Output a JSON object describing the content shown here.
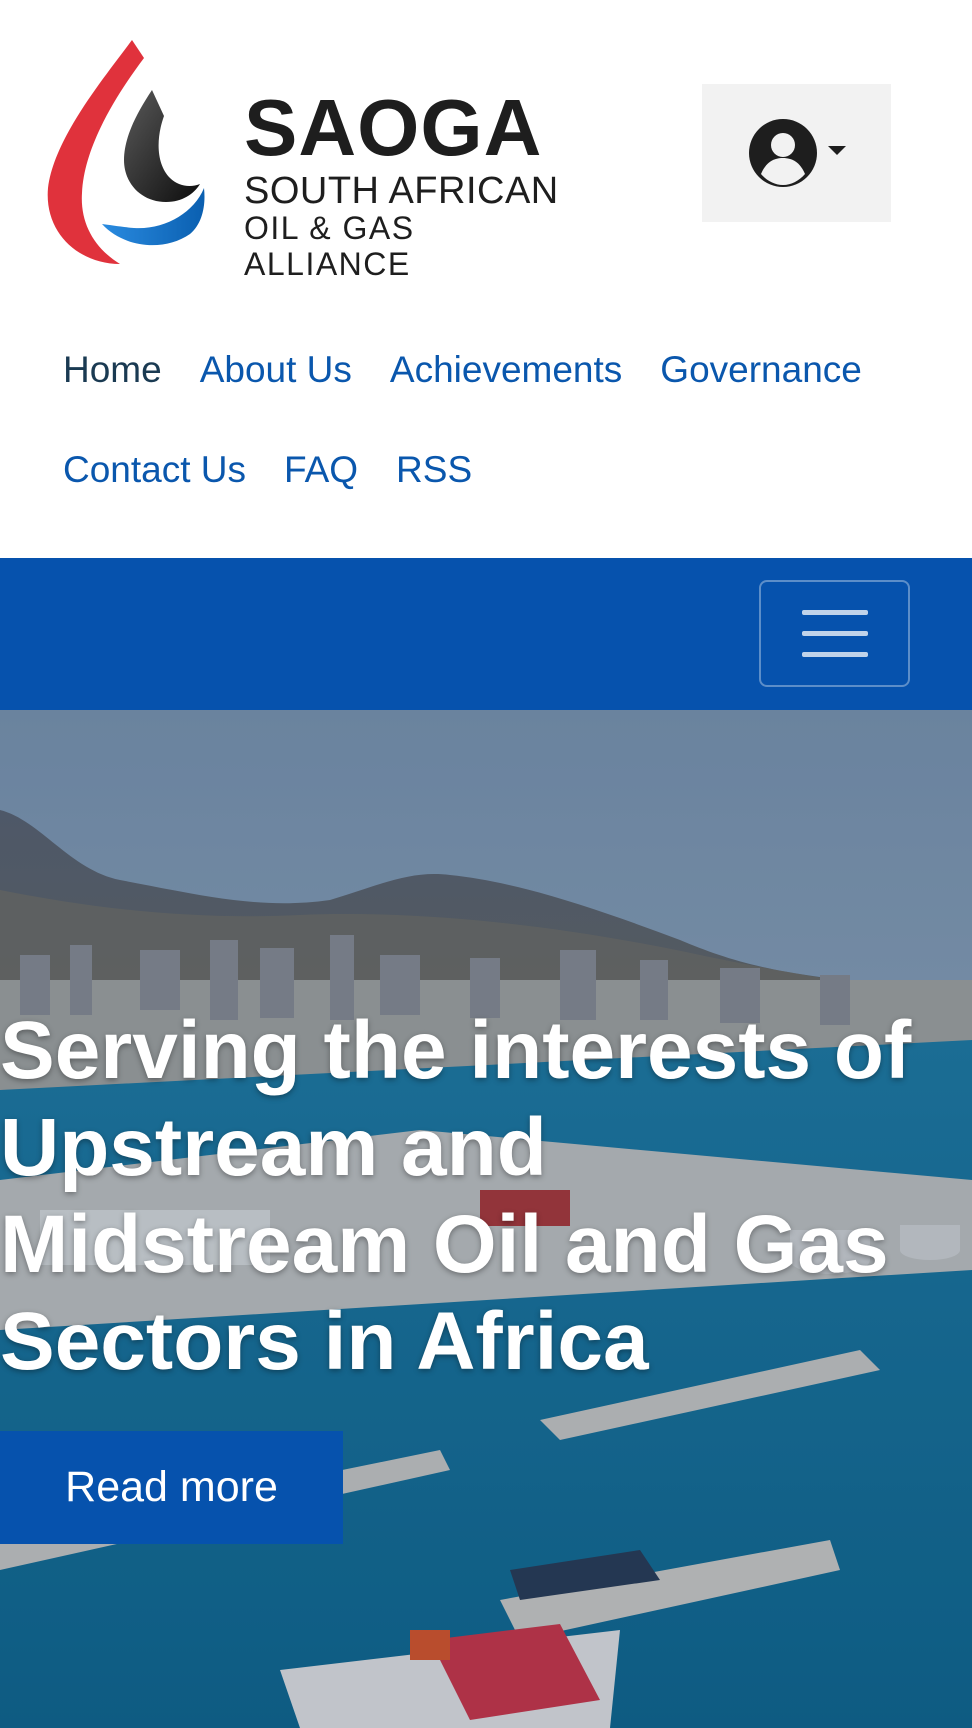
{
  "logo": {
    "brand": "SAOGA",
    "line1": "SOUTH AFRICAN",
    "line2": "OIL & GAS ALLIANCE"
  },
  "account_menu": {
    "icon": "user-circle-icon"
  },
  "nav": {
    "items": [
      {
        "label": "Home",
        "active": true
      },
      {
        "label": "About Us"
      },
      {
        "label": "Achievements"
      },
      {
        "label": "Governance"
      },
      {
        "label": "Contact Us"
      },
      {
        "label": "FAQ"
      },
      {
        "label": "RSS"
      }
    ]
  },
  "toolbar": {
    "toggler_icon": "hamburger-icon"
  },
  "hero": {
    "title": "Serving the interests of Upstream and Midstream Oil and Gas Sectors in Africa",
    "cta_label": "Read more"
  },
  "colors": {
    "brand_blue": "#0652ad",
    "link_blue": "#0a57ad",
    "logo_red": "#e0323c",
    "logo_black": "#1e1e1e",
    "logo_blue": "#1f7bd0"
  }
}
